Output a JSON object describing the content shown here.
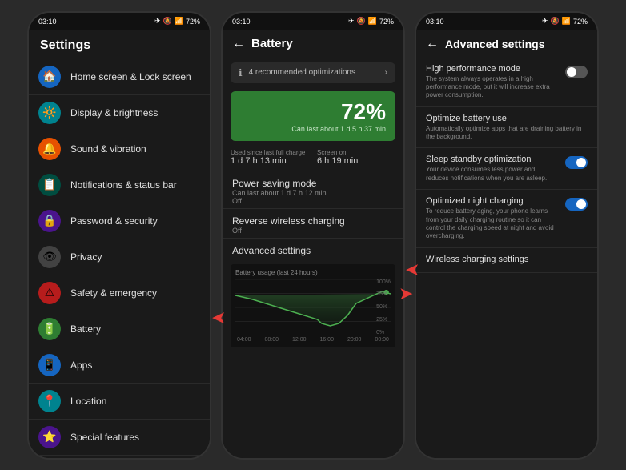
{
  "phones": [
    {
      "id": "settings",
      "status_time": "03:10",
      "battery_pct": "72%",
      "title": "Settings",
      "items": [
        {
          "icon": "🏠",
          "label": "Home screen & Lock screen",
          "color": "icon-blue"
        },
        {
          "icon": "🔆",
          "label": "Display & brightness",
          "color": "icon-cyan"
        },
        {
          "icon": "🔔",
          "label": "Sound & vibration",
          "color": "icon-orange"
        },
        {
          "icon": "📋",
          "label": "Notifications & status bar",
          "color": "icon-teal"
        },
        {
          "icon": "🔒",
          "label": "Password & security",
          "color": "icon-purple"
        },
        {
          "icon": "👁",
          "label": "Privacy",
          "color": "icon-grey"
        },
        {
          "icon": "⚠",
          "label": "Safety & emergency",
          "color": "icon-red"
        },
        {
          "icon": "🔋",
          "label": "Battery",
          "color": "icon-green",
          "arrow": true
        },
        {
          "icon": "📱",
          "label": "Apps",
          "color": "icon-blue"
        },
        {
          "icon": "📍",
          "label": "Location",
          "color": "icon-cyan"
        },
        {
          "icon": "⭐",
          "label": "Special features",
          "color": "icon-purple"
        }
      ]
    },
    {
      "id": "battery",
      "status_time": "03:10",
      "battery_pct": "72%",
      "title": "Battery",
      "optimization_text": "4 recommended optimizations",
      "battery_percentage": "72%",
      "can_last": "Can last about 1 d 5 h 37 min",
      "used_since_label": "Used since last full charge",
      "used_since_value": "1 d 7 h 13 min",
      "screen_on_label": "Screen on",
      "screen_on_value": "6 h 19 min",
      "power_saving_title": "Power saving mode",
      "power_saving_sub": "Can last about 1 d 7 h 12 min",
      "power_saving_status": "Off",
      "reverse_wireless_title": "Reverse wireless charging",
      "reverse_wireless_status": "Off",
      "advanced_settings_title": "Advanced settings",
      "chart_label": "Battery usage (last 24 hours)",
      "chart_x_labels": [
        "04:00",
        "08:00",
        "12:00",
        "16:00",
        "20:00",
        "00:00"
      ],
      "chart_y_labels": [
        "100%",
        "75%",
        "50%",
        "25%",
        "0%"
      ]
    },
    {
      "id": "advanced",
      "status_time": "03:10",
      "battery_pct": "72%",
      "title": "Advanced settings",
      "items": [
        {
          "title": "High performance mode",
          "desc": "The system always operates in a high performance mode, but it will increase extra power consumption.",
          "toggle": "off"
        },
        {
          "title": "Optimize battery use",
          "desc": "Automatically optimize apps that are draining battery in the background.",
          "toggle": "none"
        },
        {
          "title": "Sleep standby optimization",
          "desc": "Your device consumes less power and reduces notifications when you are asleep.",
          "toggle": "on"
        },
        {
          "title": "Optimized night charging",
          "desc": "To reduce battery aging, your phone learns from your daily charging routine so it can control the charging speed at night and avoid overcharging.",
          "toggle": "on",
          "arrow": true
        },
        {
          "title": "Wireless charging settings",
          "desc": "",
          "toggle": "none"
        }
      ]
    }
  ]
}
